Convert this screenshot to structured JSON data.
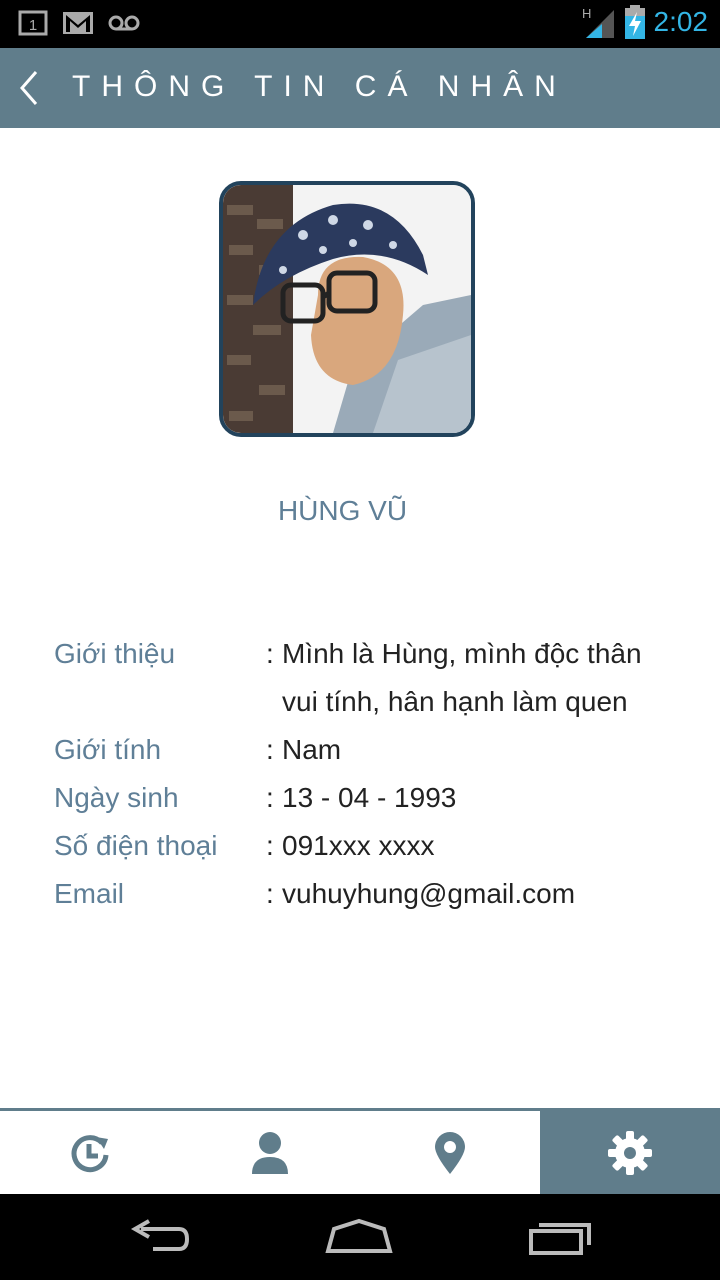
{
  "status_bar": {
    "time": "2:02",
    "notification_icons": [
      "calendar-icon",
      "gmail-icon",
      "voicemail-icon"
    ],
    "network_indicator": "H"
  },
  "header": {
    "back_icon": "chevron-left-icon",
    "title": "THÔNG TIN CÁ NHÂN"
  },
  "profile": {
    "name": "HÙNG VŨ",
    "fields": [
      {
        "label": "Giới thiệu",
        "value": "Mình là Hùng, mình độc thân vui tính, hân hạnh làm quen"
      },
      {
        "label": "Giới tính",
        "value": "Nam"
      },
      {
        "label": "Ngày sinh",
        "value": "13 - 04 - 1993"
      },
      {
        "label": "Số điện thoại",
        "value": "091xxx xxxx"
      },
      {
        "label": "Email",
        "value": "vuhuyhung@gmail.com"
      }
    ]
  },
  "bottom_nav": {
    "tabs": [
      {
        "icon": "history-icon",
        "active": false
      },
      {
        "icon": "person-icon",
        "active": false
      },
      {
        "icon": "location-pin-icon",
        "active": false
      },
      {
        "icon": "gear-icon",
        "active": true
      }
    ]
  },
  "colors": {
    "primary": "#607d8b",
    "label": "#5f7f97",
    "avatar_border": "#22435c",
    "status_accent": "#33b5e5"
  }
}
